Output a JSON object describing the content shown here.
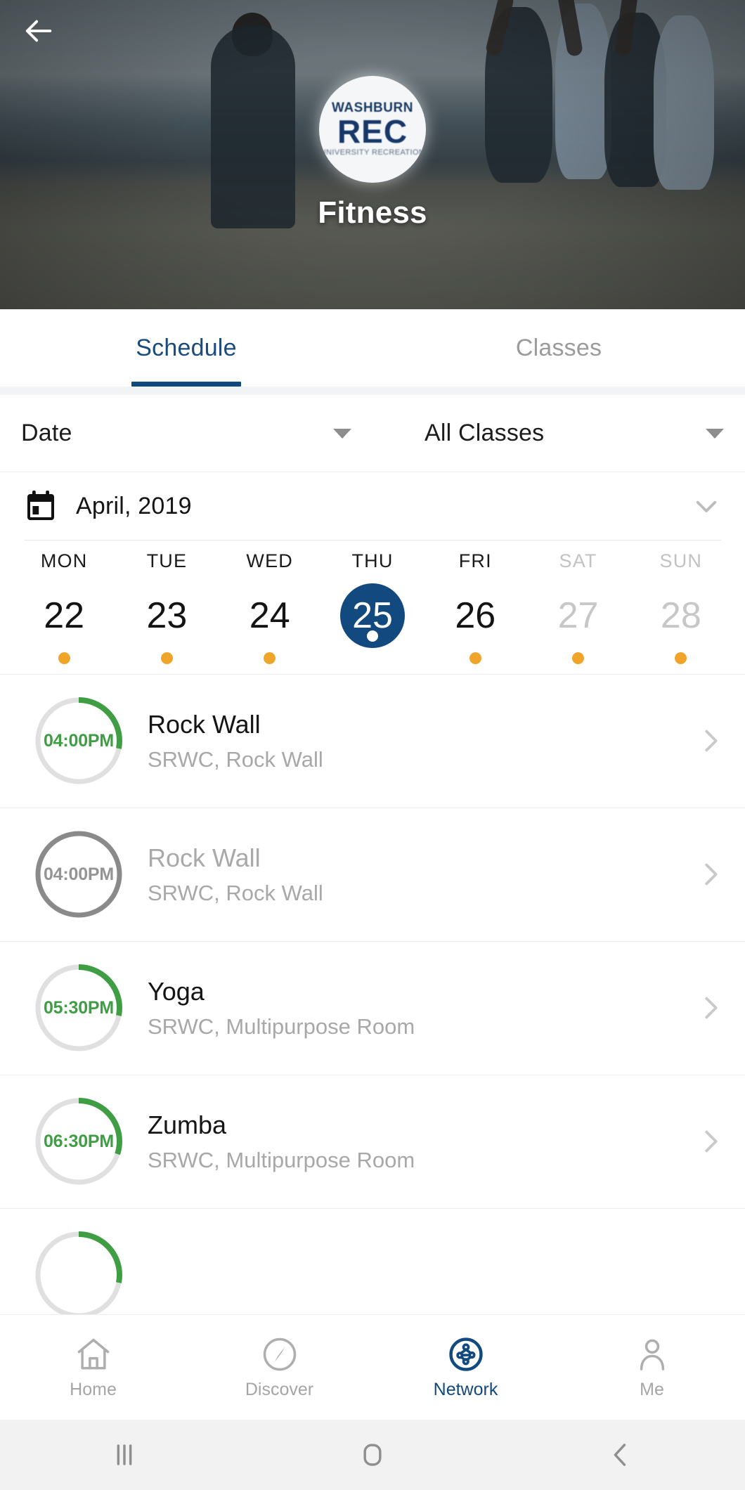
{
  "hero": {
    "back_icon": "arrow-left-icon",
    "logo": {
      "line1": "WASHBURN",
      "line2": "REC",
      "line3": "UNIVERSITY RECREATION"
    },
    "title": "Fitness"
  },
  "tabs": [
    {
      "label": "Schedule",
      "active": true
    },
    {
      "label": "Classes",
      "active": false
    }
  ],
  "filters": [
    {
      "label": "Date",
      "icon": "chevron-down-icon"
    },
    {
      "label": "All Classes",
      "icon": "chevron-down-icon"
    }
  ],
  "calendar": {
    "icon": "calendar-icon",
    "month_label": "April,  2019",
    "expand_icon": "chevron-down-icon",
    "days": [
      {
        "name": "MON",
        "num": "22",
        "selected": false,
        "weekend": false,
        "dot": true
      },
      {
        "name": "TUE",
        "num": "23",
        "selected": false,
        "weekend": false,
        "dot": true
      },
      {
        "name": "WED",
        "num": "24",
        "selected": false,
        "weekend": false,
        "dot": true
      },
      {
        "name": "THU",
        "num": "25",
        "selected": true,
        "weekend": false,
        "dot": true
      },
      {
        "name": "FRI",
        "num": "26",
        "selected": false,
        "weekend": false,
        "dot": true
      },
      {
        "name": "SAT",
        "num": "27",
        "selected": false,
        "weekend": true,
        "dot": true
      },
      {
        "name": "SUN",
        "num": "28",
        "selected": false,
        "weekend": true,
        "dot": true
      }
    ]
  },
  "classes": [
    {
      "time": "04:00PM",
      "title": "Rock Wall",
      "location": "SRWC, Rock Wall",
      "progress": 28,
      "disabled": false,
      "chevron_icon": "chevron-right-icon"
    },
    {
      "time": "04:00PM",
      "title": "Rock Wall",
      "location": "SRWC, Rock Wall",
      "progress": 100,
      "disabled": true,
      "chevron_icon": "chevron-right-icon"
    },
    {
      "time": "05:30PM",
      "title": "Yoga",
      "location": "SRWC, Multipurpose Room",
      "progress": 28,
      "disabled": false,
      "chevron_icon": "chevron-right-icon"
    },
    {
      "time": "06:30PM",
      "title": "Zumba",
      "location": "SRWC, Multipurpose Room",
      "progress": 30,
      "disabled": false,
      "chevron_icon": "chevron-right-icon"
    }
  ],
  "bottom_nav": [
    {
      "label": "Home",
      "icon": "home-icon",
      "active": false
    },
    {
      "label": "Discover",
      "icon": "compass-icon",
      "active": false
    },
    {
      "label": "Network",
      "icon": "network-icon",
      "active": true
    },
    {
      "label": "Me",
      "icon": "person-icon",
      "active": false
    }
  ],
  "system_bar": [
    {
      "name": "recents-button",
      "icon": "recents-icon"
    },
    {
      "name": "home-button",
      "icon": "home-square-icon"
    },
    {
      "name": "back-button",
      "icon": "chevron-left-icon"
    }
  ],
  "colors": {
    "brand_blue": "#12497E",
    "accent_green": "#3F9E44",
    "ring_track": "#E0E0E0",
    "ring_disabled": "#8A8A8A",
    "day_dot": "#F0A52A",
    "muted_text": "#A8A8A8"
  }
}
